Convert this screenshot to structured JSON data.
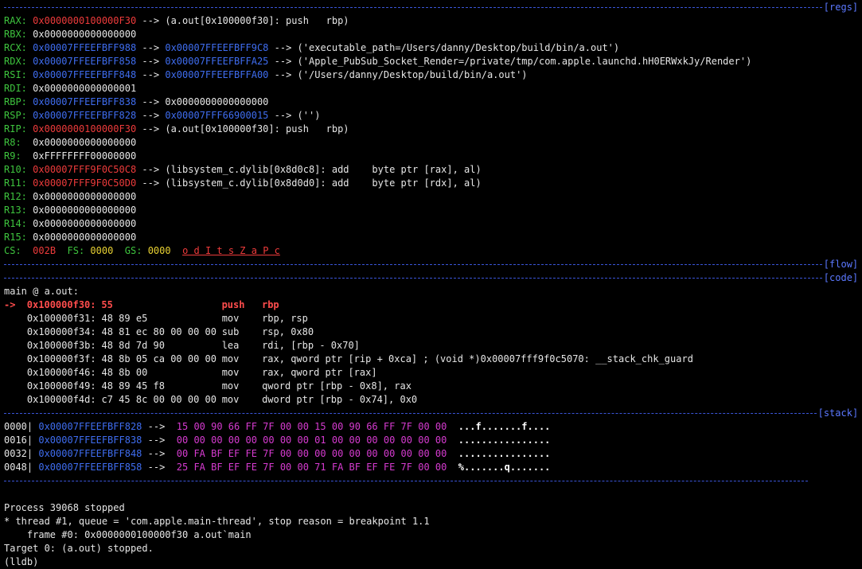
{
  "sections": {
    "regs": "[regs]",
    "flow": "[flow]",
    "code": "[code]",
    "stack": "[stack]"
  },
  "registers": [
    {
      "name": "RAX:",
      "value": "0x0000000100000F30",
      "value_color": "red",
      "arrow": "-->",
      "deref": "(a.out[0x100000f30]: push   rbp)"
    },
    {
      "name": "RBX:",
      "value": "0x0000000000000000",
      "value_color": "white"
    },
    {
      "name": "RCX:",
      "value": "0x00007FFEEFBFF988",
      "value_color": "blue",
      "arrow": "-->",
      "ptr": "0x00007FFEEFBFF9C8",
      "arrow2": "-->",
      "deref": "('executable_path=/Users/danny/Desktop/build/bin/a.out')"
    },
    {
      "name": "RDX:",
      "value": "0x00007FFEEFBFF858",
      "value_color": "blue",
      "arrow": "-->",
      "ptr": "0x00007FFEEFBFFA25",
      "arrow2": "-->",
      "deref": "('Apple_PubSub_Socket_Render=/private/tmp/com.apple.launchd.hH0ERWxkJy/Render')"
    },
    {
      "name": "RSI:",
      "value": "0x00007FFEEFBFF848",
      "value_color": "blue",
      "arrow": "-->",
      "ptr": "0x00007FFEEFBFFA00",
      "arrow2": "-->",
      "deref": "('/Users/danny/Desktop/build/bin/a.out')"
    },
    {
      "name": "RDI:",
      "value": "0x0000000000000001",
      "value_color": "white"
    },
    {
      "name": "RBP:",
      "value": "0x00007FFEEFBFF838",
      "value_color": "blue",
      "arrow": "-->",
      "deref": "0x0000000000000000"
    },
    {
      "name": "RSP:",
      "value": "0x00007FFEEFBFF828",
      "value_color": "blue",
      "arrow": "-->",
      "ptr": "0x00007FFF66900015",
      "arrow2": "-->",
      "deref": "('')"
    },
    {
      "name": "RIP:",
      "value": "0x0000000100000F30",
      "value_color": "red",
      "arrow": "-->",
      "deref": "(a.out[0x100000f30]: push   rbp)"
    },
    {
      "name": "R8: ",
      "value": "0x0000000000000000",
      "value_color": "white"
    },
    {
      "name": "R9: ",
      "value": "0xFFFFFFFF00000000",
      "value_color": "white"
    },
    {
      "name": "R10:",
      "value": "0x00007FFF9F0C50C8",
      "value_color": "red",
      "arrow": "-->",
      "deref": "(libsystem_c.dylib[0x8d0c8]: add    byte ptr [rax], al)"
    },
    {
      "name": "R11:",
      "value": "0x00007FFF9F0C50D0",
      "value_color": "red",
      "arrow": "-->",
      "deref": "(libsystem_c.dylib[0x8d0d0]: add    byte ptr [rdx], al)"
    },
    {
      "name": "R12:",
      "value": "0x0000000000000000",
      "value_color": "white"
    },
    {
      "name": "R13:",
      "value": "0x0000000000000000",
      "value_color": "white"
    },
    {
      "name": "R14:",
      "value": "0x0000000000000000",
      "value_color": "white"
    },
    {
      "name": "R15:",
      "value": "0x0000000000000000",
      "value_color": "white"
    }
  ],
  "segments": {
    "cs_label": "CS:",
    "cs_value": "002B",
    "fs_label": "FS:",
    "fs_value": "0000",
    "gs_label": "GS:",
    "gs_value": "0000",
    "flags": "o d I t s Z a P c"
  },
  "code": {
    "header": "main @ a.out:",
    "current": {
      "marker": "->",
      "address": "0x100000f30:",
      "bytes": "55",
      "mnemonic": "push",
      "operands": "rbp"
    },
    "lines": [
      {
        "address": "0x100000f31:",
        "bytes": "48 89 e5",
        "mnemonic": "mov",
        "operands": "rbp, rsp"
      },
      {
        "address": "0x100000f34:",
        "bytes": "48 81 ec 80 00 00 00",
        "mnemonic": "sub",
        "operands": "rsp, 0x80"
      },
      {
        "address": "0x100000f3b:",
        "bytes": "48 8d 7d 90",
        "mnemonic": "lea",
        "operands": "rdi, [rbp - 0x70]"
      },
      {
        "address": "0x100000f3f:",
        "bytes": "48 8b 05 ca 00 00 00",
        "mnemonic": "mov",
        "operands": "rax, qword ptr [rip + 0xca] ; (void *)0x00007fff9f0c5070: __stack_chk_guard"
      },
      {
        "address": "0x100000f46:",
        "bytes": "48 8b 00",
        "mnemonic": "mov",
        "operands": "rax, qword ptr [rax]"
      },
      {
        "address": "0x100000f49:",
        "bytes": "48 89 45 f8",
        "mnemonic": "mov",
        "operands": "qword ptr [rbp - 0x8], rax"
      },
      {
        "address": "0x100000f4d:",
        "bytes": "c7 45 8c 00 00 00 00",
        "mnemonic": "mov",
        "operands": "dword ptr [rbp - 0x74], 0x0"
      }
    ]
  },
  "stack": [
    {
      "offset": "0000|",
      "address": "0x00007FFEEFBFF828",
      "arrow": "-->",
      "hex": "15 00 90 66 FF 7F 00 00 15 00 90 66 FF 7F 00 00",
      "ascii": "...f.......f...."
    },
    {
      "offset": "0016|",
      "address": "0x00007FFEEFBFF838",
      "arrow": "-->",
      "hex": "00 00 00 00 00 00 00 00 01 00 00 00 00 00 00 00",
      "ascii": "................"
    },
    {
      "offset": "0032|",
      "address": "0x00007FFEEFBFF848",
      "arrow": "-->",
      "hex": "00 FA BF EF FE 7F 00 00 00 00 00 00 00 00 00 00",
      "ascii": "................"
    },
    {
      "offset": "0048|",
      "address": "0x00007FFEEFBFF858",
      "arrow": "-->",
      "hex": "25 FA BF EF FE 7F 00 00 71 FA BF EF FE 7F 00 00",
      "ascii": "%.......q......."
    }
  ],
  "console": [
    "Process 39068 stopped",
    "* thread #1, queue = 'com.apple.main-thread', stop reason = breakpoint 1.1",
    "    frame #0: 0x0000000100000f30 a.out`main",
    "Target 0: (a.out) stopped.",
    "(lldb)"
  ],
  "colors": {
    "background": "#000000",
    "register_name": "#3ec43e",
    "pointer_code": "#ee3b3b",
    "pointer_stack": "#3f6df0",
    "hex_bytes": "#d63bd0",
    "segment_value": "#e8d133",
    "separator": "#3a55d8"
  }
}
